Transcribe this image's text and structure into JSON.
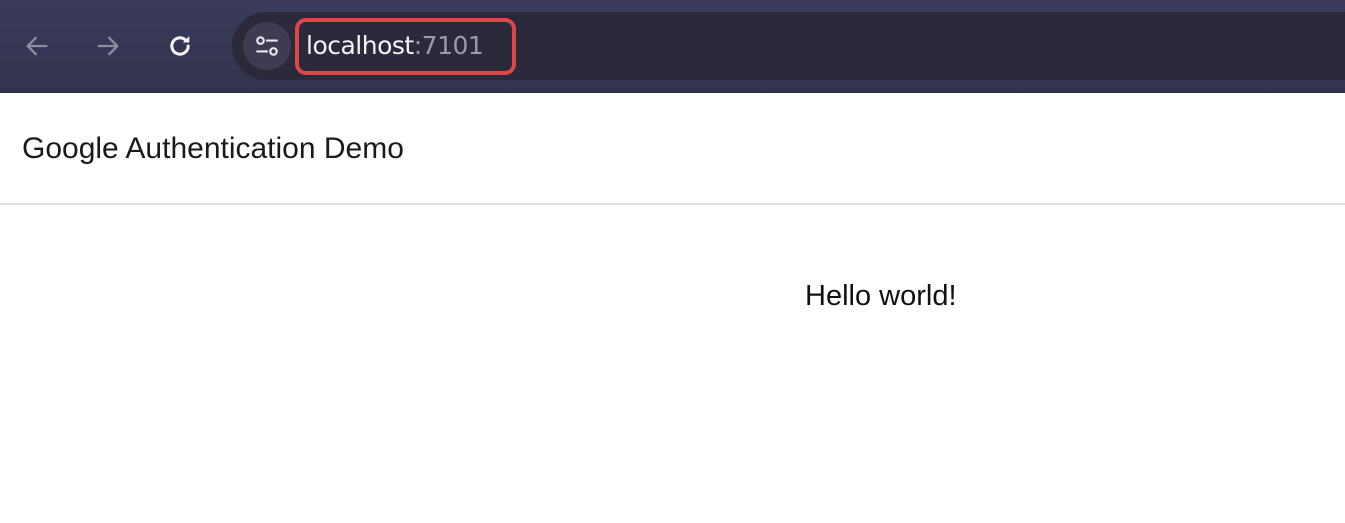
{
  "browser": {
    "address_bar": {
      "host": "localhost",
      "port": ":7101"
    },
    "icons": {
      "back": "arrow-left-icon",
      "forward": "arrow-right-icon",
      "reload": "reload-icon",
      "site_info": "tune-icon"
    },
    "highlight_color": "#e0454a"
  },
  "header": {
    "title": "Google Authentication Demo"
  },
  "main": {
    "message": "Hello world!"
  }
}
